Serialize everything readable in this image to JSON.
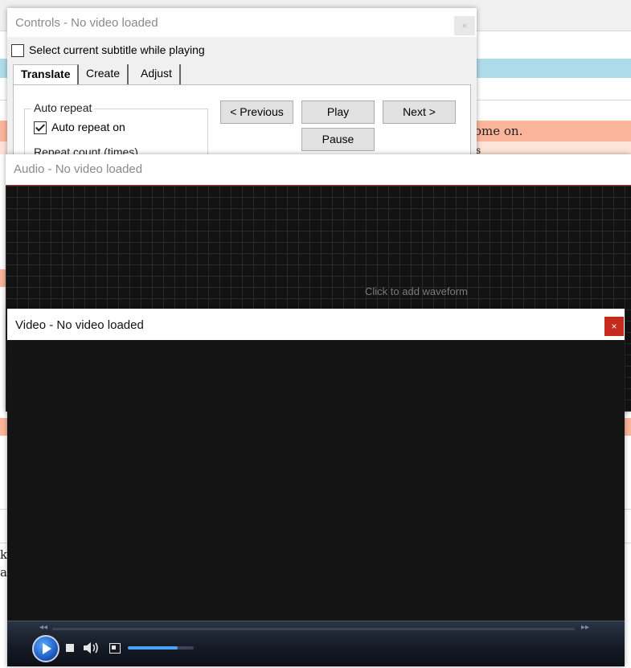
{
  "background_app": {
    "fragment_1": "ome on.",
    "fragment_2": "s",
    "fragment_3": "k",
    "fragment_4": "a",
    "colors": {
      "blue_band": "#aedbea",
      "salmon_band": "#fbb59a"
    }
  },
  "controls_window": {
    "title": "Controls - No video loaded",
    "close_label": "×",
    "select_subtitle_label": "Select current subtitle while playing",
    "select_subtitle_checked": false,
    "tabs": [
      {
        "label": "Translate",
        "active": true
      },
      {
        "label": "Create",
        "active": false
      },
      {
        "label": "Adjust",
        "active": false
      }
    ],
    "auto_repeat": {
      "group_title": "Auto repeat",
      "checkbox_label": "Auto repeat on",
      "checked": true,
      "repeat_count_label": "Repeat count (times)"
    },
    "buttons": {
      "previous": "< Previous",
      "play": "Play",
      "next": "Next >",
      "pause": "Pause"
    }
  },
  "audio_window": {
    "title": "Audio - No video loaded",
    "waveform_hint": "Click to add waveform"
  },
  "video_window": {
    "title": "Video - No video loaded",
    "close_label": "×",
    "player": {
      "icons": [
        "play-icon",
        "stop-icon",
        "volume-icon",
        "fullscreen-icon"
      ],
      "seek_left_glyph": "◂◂",
      "seek_right_glyph": "▸▸",
      "volume_level": 0.75,
      "accent_color": "#4aa3ff"
    }
  }
}
